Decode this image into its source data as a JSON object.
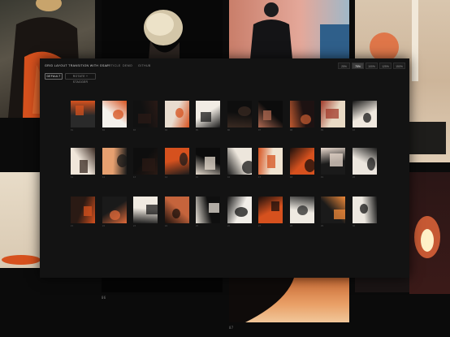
{
  "app": {
    "title": "GRID LAYOUT TRANSITION WITH GSAP",
    "nav": [
      "ARTICLE",
      "DEMO",
      "GITHUB"
    ],
    "zoom_levels": [
      "25%",
      "75%",
      "100%",
      "125%",
      "150%"
    ],
    "zoom_active": "75%",
    "filters": [
      "DEFAULT",
      "ROTATE + STAGGER"
    ],
    "filter_active": "DEFAULT"
  },
  "background": {
    "captions": [
      "06",
      "07"
    ]
  },
  "grid": {
    "rows": [
      {
        "captions": [
          "01",
          "02",
          "03",
          "04",
          "05",
          "06",
          "07",
          "08",
          "09",
          "10"
        ]
      },
      {
        "captions": [
          "11",
          "12",
          "13",
          "14",
          "15",
          "16",
          "17",
          "18",
          "19",
          "20"
        ]
      },
      {
        "captions": [
          "21",
          "22",
          "23",
          "24",
          "25",
          "26",
          "27",
          "28",
          "29",
          "30"
        ]
      }
    ]
  },
  "icons": {
    "thumbnail": "photo-icon"
  },
  "colors": {
    "background": "#0b0b0b",
    "panel": "#131313",
    "accent_orange": "#d6511e",
    "active_zoom": "#3a3a3a"
  }
}
